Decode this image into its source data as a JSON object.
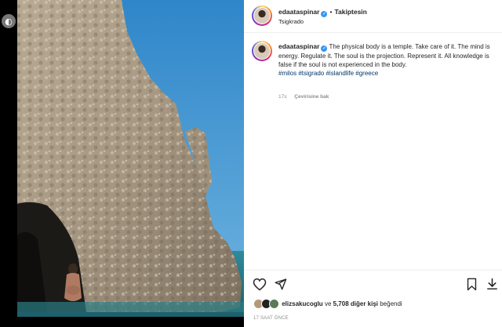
{
  "post": {
    "username": "edaataspinar",
    "follow_label": "Takiptesin",
    "separator": "•",
    "location": "Tsigkrado",
    "caption_text": "The physical body is a temple. Take care of it. The mind is energy. Regulate it. The soul is the projection. Represent it. All knowledge is false if the soul is not experienced in the body.",
    "hashtags": "#milos #tsigrado #islandlife #greece",
    "caption_age": "17s",
    "translate_label": "Çevirisine bak",
    "likes_user": "elizsakucoglu",
    "likes_and": "ve",
    "likes_others": "5,708 diğer kişi",
    "likes_suffix": "beğendi",
    "timestamp": "17 SAAT ÖNCE"
  },
  "icons": {
    "like": "heart-icon",
    "share": "send-icon",
    "save": "bookmark-icon",
    "download": "download-icon",
    "verified": "verified-badge-icon"
  },
  "colors": {
    "verified": "#3897f0",
    "hashtag": "#00376b",
    "muted": "#8e8e8e",
    "text": "#262626"
  }
}
